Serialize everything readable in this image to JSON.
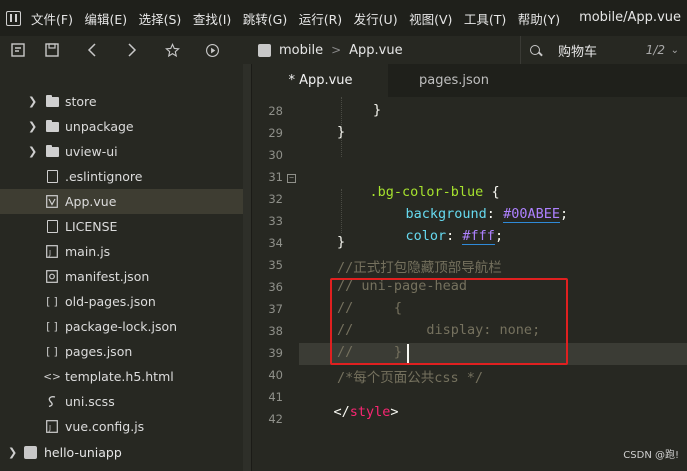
{
  "menubar": {
    "items": [
      "文件(F)",
      "编辑(E)",
      "选择(S)",
      "查找(I)",
      "跳转(G)",
      "运行(R)",
      "发行(U)",
      "视图(V)",
      "工具(T)",
      "帮助(Y)"
    ],
    "window_title": "mobile/App.vue"
  },
  "toolbar": {
    "icons": [
      "format-icon",
      "save-icon",
      "back-icon",
      "forward-icon",
      "star-icon",
      "run-icon"
    ],
    "breadcrumb": [
      "mobile",
      "App.vue"
    ],
    "search_text": "购物车",
    "search_count": "1/2"
  },
  "sidebar": {
    "items": [
      {
        "label": "store",
        "icon": "folder-icon",
        "expandable": true
      },
      {
        "label": "unpackage",
        "icon": "folder-icon",
        "expandable": true
      },
      {
        "label": "uview-ui",
        "icon": "folder-icon",
        "expandable": true
      },
      {
        "label": ".eslintignore",
        "icon": "file-icon",
        "expandable": false
      },
      {
        "label": "App.vue",
        "icon": "vue-file-icon",
        "expandable": false,
        "selected": true
      },
      {
        "label": "LICENSE",
        "icon": "file-icon",
        "expandable": false
      },
      {
        "label": "main.js",
        "icon": "js-file-icon",
        "expandable": false
      },
      {
        "label": "manifest.json",
        "icon": "manifest-icon",
        "expandable": false
      },
      {
        "label": "old-pages.json",
        "icon": "json-file-icon",
        "expandable": false
      },
      {
        "label": "package-lock.json",
        "icon": "json-file-icon",
        "expandable": false
      },
      {
        "label": "pages.json",
        "icon": "json-file-icon",
        "expandable": false
      },
      {
        "label": "template.h5.html",
        "icon": "html-file-icon",
        "expandable": false
      },
      {
        "label": "uni.scss",
        "icon": "scss-file-icon",
        "expandable": false
      },
      {
        "label": "vue.config.js",
        "icon": "js-file-icon",
        "expandable": false
      }
    ],
    "project": "hello-uniapp"
  },
  "tabs": [
    {
      "label": "* App.vue",
      "active": true
    },
    {
      "label": "pages.json",
      "active": false
    }
  ],
  "editor": {
    "line_numbers": [
      "28",
      "29",
      "30",
      "31",
      "32",
      "33",
      "34",
      "35",
      "36",
      "37",
      "38",
      "39",
      "40",
      "41",
      "42"
    ],
    "lines": {
      "l28": "}",
      "l29": "}",
      "l31_selector": ".bg-color-blue",
      "l31_brace": " {",
      "l32_prop": "background",
      "l32_val": "#00ABEE",
      "l33_prop": "color",
      "l33_val": "#fff",
      "l34": "}",
      "l35": "//正式打包隐藏顶部导航栏",
      "l36": "// uni-page-head",
      "l37": "//     {",
      "l38": "//         display: none;",
      "l39": "//     }",
      "l40": "/*每个页面公共css */",
      "l41_open": "</",
      "l41_tag": "style",
      "l41_close": ">"
    }
  },
  "watermark": "CSDN @跑!"
}
